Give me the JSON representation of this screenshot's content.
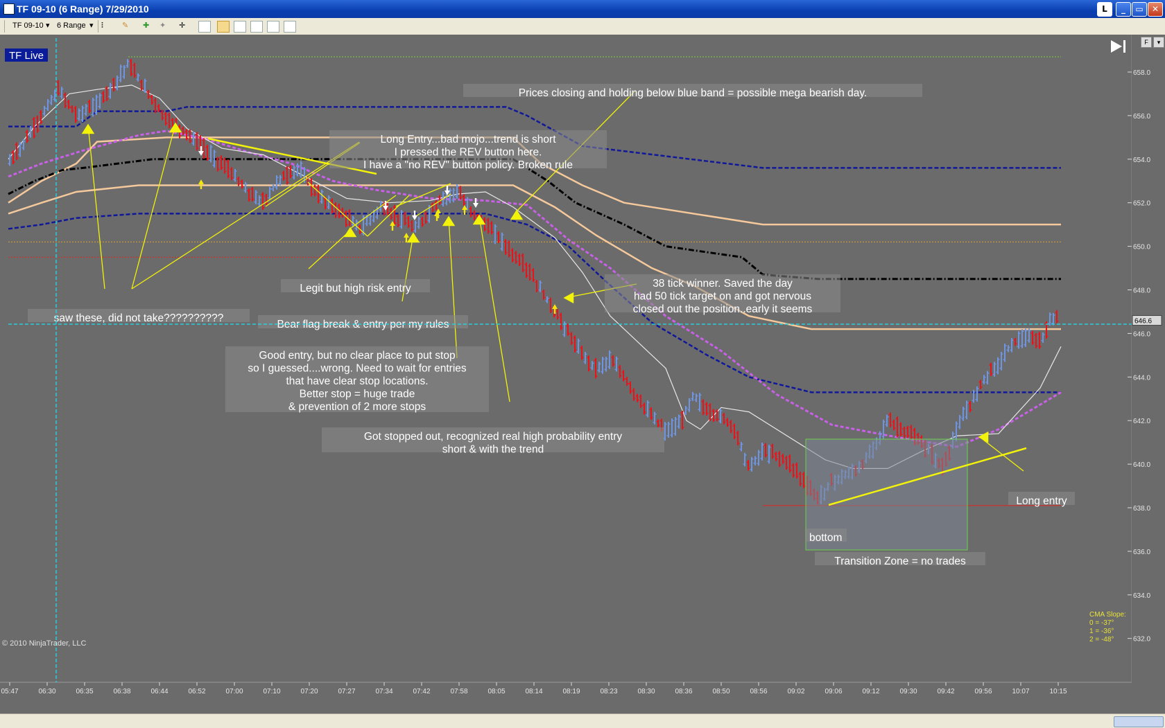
{
  "window": {
    "title": "TF 09-10 (6 Range)  7/29/2010",
    "buttons": [
      "L",
      "_",
      "▭",
      "✕"
    ]
  },
  "toolbar": {
    "instrument": "TF 09-10",
    "period": "6 Range"
  },
  "chart": {
    "live_label": "TF Live",
    "copyright": "© 2010 NinjaTrader, LLC",
    "price_label": "646.6",
    "y_ticks": [
      "658.0",
      "656.0",
      "654.0",
      "652.0",
      "650.0",
      "648.0",
      "646.0",
      "644.0",
      "642.0",
      "640.0",
      "638.0",
      "636.0",
      "634.0",
      "632.0"
    ],
    "x_ticks": [
      "05:47",
      "06:30",
      "06:35",
      "06:38",
      "06:44",
      "06:52",
      "07:00",
      "07:10",
      "07:20",
      "07:27",
      "07:34",
      "07:42",
      "07:58",
      "08:05",
      "08:14",
      "08:19",
      "08:23",
      "08:30",
      "08:36",
      "08:50",
      "08:56",
      "09:02",
      "09:06",
      "09:12",
      "09:30",
      "09:42",
      "09:56",
      "10:07",
      "10:15"
    ],
    "cma": {
      "title": "CMA Slope:",
      "lines": [
        "0 = -37°",
        "1 = -36°",
        "2 = -48°"
      ]
    },
    "annotations": {
      "prices_closing": "Prices closing and holding below blue band = possible mega bearish day.",
      "long_entry_bad": [
        "Long Entry...bad mojo...trend is short",
        "I pressed the REV button here.",
        "I have a \"no REV\" button policy. Broken rule"
      ],
      "legit": "Legit but high risk entry",
      "saw_these": "saw these, did not take??????????",
      "bear_flag": "Bear flag break & entry per my rules",
      "good_entry": [
        "Good entry, but no clear place to put stop",
        "so I guessed....wrong. Need to wait for entries",
        "that have clear stop locations.",
        "Better stop = huge trade",
        "& prevention of 2 more stops"
      ],
      "stopped_out": [
        "Got stopped out, recognized real high probability entry",
        "short & with the trend"
      ],
      "winner": [
        "38 tick winner. Saved the day",
        "had 50 tick target on and got nervous",
        "closed out the position..early it seems"
      ],
      "bottom": "bottom",
      "transition": "Transition Zone = no trades",
      "long_entry": "Long entry"
    },
    "colors": {
      "background": "#6b6b6b",
      "up_bar": "#6f94e0",
      "down_bar": "#e8141c",
      "blue_band": "#10189a",
      "orange_band": "#f5c99c",
      "black_band": "#000000",
      "magenta": "#c860e8",
      "annotation_line": "#f2f20a",
      "cyan": "#26d0dc"
    }
  }
}
